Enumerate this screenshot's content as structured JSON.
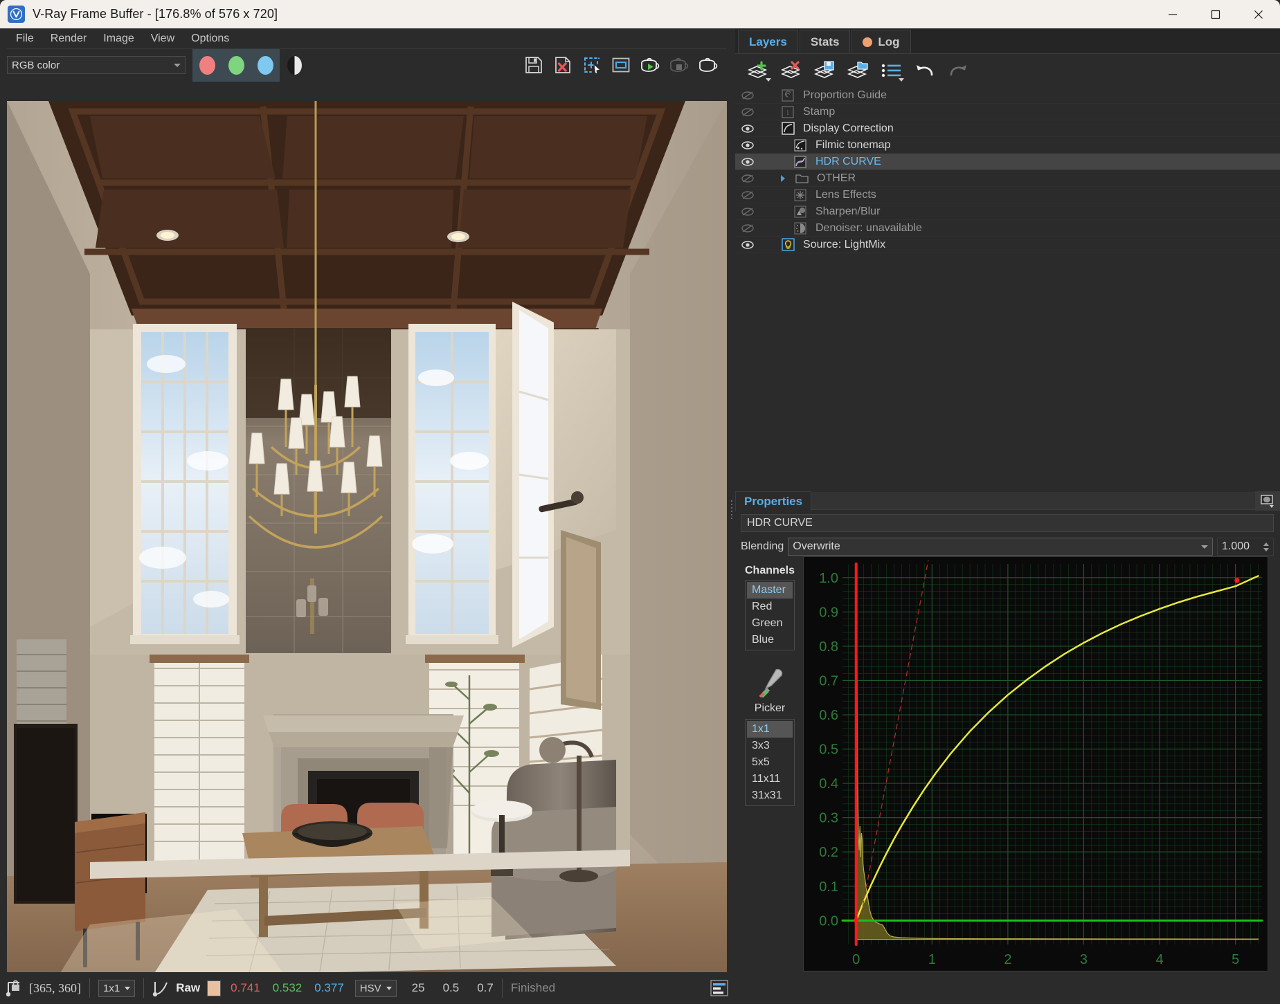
{
  "window": {
    "title": "V-Ray Frame Buffer - [176.8% of 576 x 720]",
    "logo_icon": "vray-logo-icon",
    "minimize_label": "—",
    "maximize_label": "□",
    "close_label": "✕"
  },
  "menubar": {
    "items": [
      {
        "label": "File"
      },
      {
        "label": "Render"
      },
      {
        "label": "Image"
      },
      {
        "label": "View"
      },
      {
        "label": "Options"
      }
    ]
  },
  "toolbar": {
    "channel_select": {
      "value": "RGB color"
    },
    "red_channel_label": "red-channel",
    "green_channel_label": "green-channel",
    "blue_channel_label": "blue-channel",
    "alpha_channel_label": "alpha-channel",
    "buttons": [
      {
        "name": "save-image-icon"
      },
      {
        "name": "clear-image-icon"
      },
      {
        "name": "region-select-icon"
      },
      {
        "name": "viewport-render-icon"
      },
      {
        "name": "render-icon"
      },
      {
        "name": "stop-render-icon"
      },
      {
        "name": "render-last-icon"
      }
    ]
  },
  "statusbar": {
    "pixel_lock_icon": "pixel-lock-icon",
    "coordinates": "[365, 360]",
    "sample_size": "1x1",
    "curve_icon": "curve-icon",
    "mode_label": "Raw",
    "swatch_color": "#e8c2a0",
    "r_value": "0.741",
    "g_value": "0.532",
    "b_value": "0.377",
    "color_space": "HSV",
    "h_value": "25",
    "s_value": "0.5",
    "v_value": "0.7",
    "render_status": "Finished",
    "log_icon": "log-panel-icon"
  },
  "panel": {
    "tabs": [
      {
        "label": "Layers",
        "active": true,
        "icon": null
      },
      {
        "label": "Stats",
        "active": false,
        "icon": null
      },
      {
        "label": "Log",
        "active": false,
        "icon": "log-status-dot",
        "icon_color": "#f0a070"
      }
    ],
    "layer_toolbar": [
      {
        "name": "add-layer-button",
        "icon": "add-layer-icon",
        "has_dropdown": true
      },
      {
        "name": "delete-layer-button",
        "icon": "delete-layer-icon",
        "has_dropdown": false
      },
      {
        "name": "save-layers-button",
        "icon": "save-layers-icon",
        "has_dropdown": false
      },
      {
        "name": "load-layers-button",
        "icon": "load-layers-icon",
        "has_dropdown": false
      },
      {
        "name": "layer-presets-button",
        "icon": "list-icon",
        "has_dropdown": true
      },
      {
        "name": "undo-button",
        "icon": "undo-icon",
        "has_dropdown": false
      },
      {
        "name": "redo-button",
        "icon": "redo-icon",
        "has_dropdown": false
      }
    ],
    "layers": [
      {
        "label": "Proportion Guide",
        "visible": false,
        "icon": "proportion-guide-icon",
        "indent": 0,
        "selected": false,
        "expandable": false
      },
      {
        "label": "Stamp",
        "visible": false,
        "icon": "stamp-icon",
        "indent": 0,
        "selected": false,
        "expandable": false
      },
      {
        "label": "Display Correction",
        "visible": true,
        "icon": "display-correction-icon",
        "indent": 0,
        "selected": false,
        "expandable": false
      },
      {
        "label": "Filmic tonemap",
        "visible": true,
        "icon": "filmic-tonemap-icon",
        "indent": 1,
        "selected": false,
        "expandable": false
      },
      {
        "label": "HDR CURVE",
        "visible": true,
        "icon": "hdr-curve-icon",
        "indent": 1,
        "selected": true,
        "expandable": false
      },
      {
        "label": "OTHER",
        "visible": false,
        "icon": "folder-icon",
        "indent": 1,
        "selected": false,
        "expandable": true
      },
      {
        "label": "Lens Effects",
        "visible": false,
        "icon": "lens-effects-icon",
        "indent": 1,
        "selected": false,
        "expandable": false
      },
      {
        "label": "Sharpen/Blur",
        "visible": false,
        "icon": "sharpen-blur-icon",
        "indent": 1,
        "selected": false,
        "expandable": false
      },
      {
        "label": "Denoiser: unavailable",
        "visible": false,
        "icon": "denoiser-icon",
        "indent": 1,
        "selected": false,
        "expandable": false
      },
      {
        "label": "Source: LightMix",
        "visible": true,
        "icon": "lightmix-icon",
        "indent": 0,
        "selected": false,
        "expandable": false
      }
    ]
  },
  "properties": {
    "header": "Properties",
    "mask_button": "mask-preview-icon",
    "layer_name": "HDR CURVE",
    "blending_label": "Blending",
    "blending_value": "Overwrite",
    "opacity_value": "1.000",
    "channels_title": "Channels",
    "channels": [
      {
        "label": "Master",
        "selected": true
      },
      {
        "label": "Red",
        "selected": false
      },
      {
        "label": "Green",
        "selected": false
      },
      {
        "label": "Blue",
        "selected": false
      }
    ],
    "picker_icon": "eyedropper-icon",
    "picker_label": "Picker",
    "picker_sizes": [
      {
        "label": "1x1",
        "selected": true
      },
      {
        "label": "3x3",
        "selected": false
      },
      {
        "label": "5x5",
        "selected": false
      },
      {
        "label": "11x11",
        "selected": false
      },
      {
        "label": "31x31",
        "selected": false
      }
    ]
  },
  "chart_data": {
    "type": "line",
    "title": "HDR Curve editor",
    "xlabel": "",
    "ylabel": "",
    "xlim": [
      -0.18,
      5.35
    ],
    "ylim": [
      -0.07,
      1.04
    ],
    "xticks": [
      0,
      1,
      2,
      3,
      4,
      5
    ],
    "yticks": [
      0.0,
      0.1,
      0.2,
      0.3,
      0.4,
      0.5,
      0.6,
      0.7,
      0.8,
      0.9,
      1.0
    ],
    "ytick_labels": [
      "0.0",
      "0.1",
      "0.2",
      "0.3",
      "0.4",
      "0.5",
      "0.6",
      "0.7",
      "0.8",
      "0.9",
      "1.0"
    ],
    "xtick_labels": [
      "0",
      "1",
      "2",
      "3",
      "4",
      "5"
    ],
    "grid": true,
    "grid_color": "#1f5a2a",
    "minor_grid_color": "#143d1c",
    "background": "#0a0a0a",
    "legend": "none",
    "series": [
      {
        "name": "tone curve",
        "color": "#e8e83c",
        "style": "solid",
        "width": 2.5,
        "points": [
          [
            0.0,
            0.0
          ],
          [
            0.1,
            0.055
          ],
          [
            0.2,
            0.105
          ],
          [
            0.3,
            0.152
          ],
          [
            0.4,
            0.196
          ],
          [
            0.5,
            0.238
          ],
          [
            0.6,
            0.277
          ],
          [
            0.75,
            0.332
          ],
          [
            0.9,
            0.383
          ],
          [
            1.05,
            0.43
          ],
          [
            1.25,
            0.488
          ],
          [
            1.5,
            0.552
          ],
          [
            1.75,
            0.608
          ],
          [
            2.0,
            0.658
          ],
          [
            2.25,
            0.702
          ],
          [
            2.5,
            0.742
          ],
          [
            2.75,
            0.778
          ],
          [
            3.0,
            0.81
          ],
          [
            3.25,
            0.839
          ],
          [
            3.5,
            0.865
          ],
          [
            3.75,
            0.888
          ],
          [
            4.0,
            0.909
          ],
          [
            4.25,
            0.928
          ],
          [
            4.5,
            0.945
          ],
          [
            4.75,
            0.96
          ],
          [
            5.0,
            0.975
          ],
          [
            5.3,
            1.005
          ]
        ]
      },
      {
        "name": "identity reference",
        "color": "#b03030",
        "style": "dashed",
        "width": 1.2,
        "points": [
          [
            0.0,
            -0.06
          ],
          [
            0.95,
            1.05
          ]
        ]
      },
      {
        "name": "zero baseline",
        "color": "#18c018",
        "style": "solid",
        "width": 3,
        "points": [
          [
            -0.18,
            0.0
          ],
          [
            5.35,
            0.0
          ]
        ]
      },
      {
        "name": "input marker",
        "color": "#ff1a1a",
        "style": "solid",
        "width": 4,
        "points": [
          [
            0.0,
            -0.07
          ],
          [
            0.0,
            1.04
          ]
        ]
      }
    ],
    "control_points": [
      {
        "x": 0.0,
        "y": 0.0,
        "color": "#ff1a1a"
      },
      {
        "x": 5.02,
        "y": 0.992,
        "color": "#ff1a1a"
      }
    ],
    "histogram": {
      "name": "luminance histogram",
      "fill": "#6b6420",
      "stroke": "#b9ae4a",
      "bins": [
        [
          0.0,
          0.0
        ],
        [
          0.01,
          0.86
        ],
        [
          0.02,
          0.45
        ],
        [
          0.03,
          0.3
        ],
        [
          0.04,
          0.26
        ],
        [
          0.05,
          0.33
        ],
        [
          0.06,
          0.24
        ],
        [
          0.07,
          0.31
        ],
        [
          0.08,
          0.29
        ],
        [
          0.09,
          0.22
        ],
        [
          0.1,
          0.2
        ],
        [
          0.12,
          0.17
        ],
        [
          0.14,
          0.14
        ],
        [
          0.16,
          0.11
        ],
        [
          0.18,
          0.085
        ],
        [
          0.2,
          0.068
        ],
        [
          0.23,
          0.056
        ],
        [
          0.26,
          0.05
        ],
        [
          0.29,
          0.047
        ],
        [
          0.32,
          0.044
        ],
        [
          0.35,
          0.042
        ],
        [
          0.38,
          0.03
        ],
        [
          0.41,
          0.018
        ],
        [
          0.45,
          0.01
        ],
        [
          0.5,
          0.007
        ],
        [
          0.6,
          0.005
        ],
        [
          0.7,
          0.004
        ],
        [
          0.85,
          0.003
        ],
        [
          1.0,
          0.0025
        ],
        [
          1.3,
          0.002
        ],
        [
          1.7,
          0.0018
        ],
        [
          2.2,
          0.0016
        ],
        [
          2.8,
          0.0014
        ],
        [
          3.4,
          0.0012
        ],
        [
          4.0,
          0.0011
        ],
        [
          4.6,
          0.001
        ],
        [
          5.3,
          0.001
        ]
      ]
    }
  },
  "render_image": {
    "name": "interior-living-room-render",
    "description": "Two-story living room with coffered wood ceiling, chandelier, fireplace, tall windows"
  }
}
